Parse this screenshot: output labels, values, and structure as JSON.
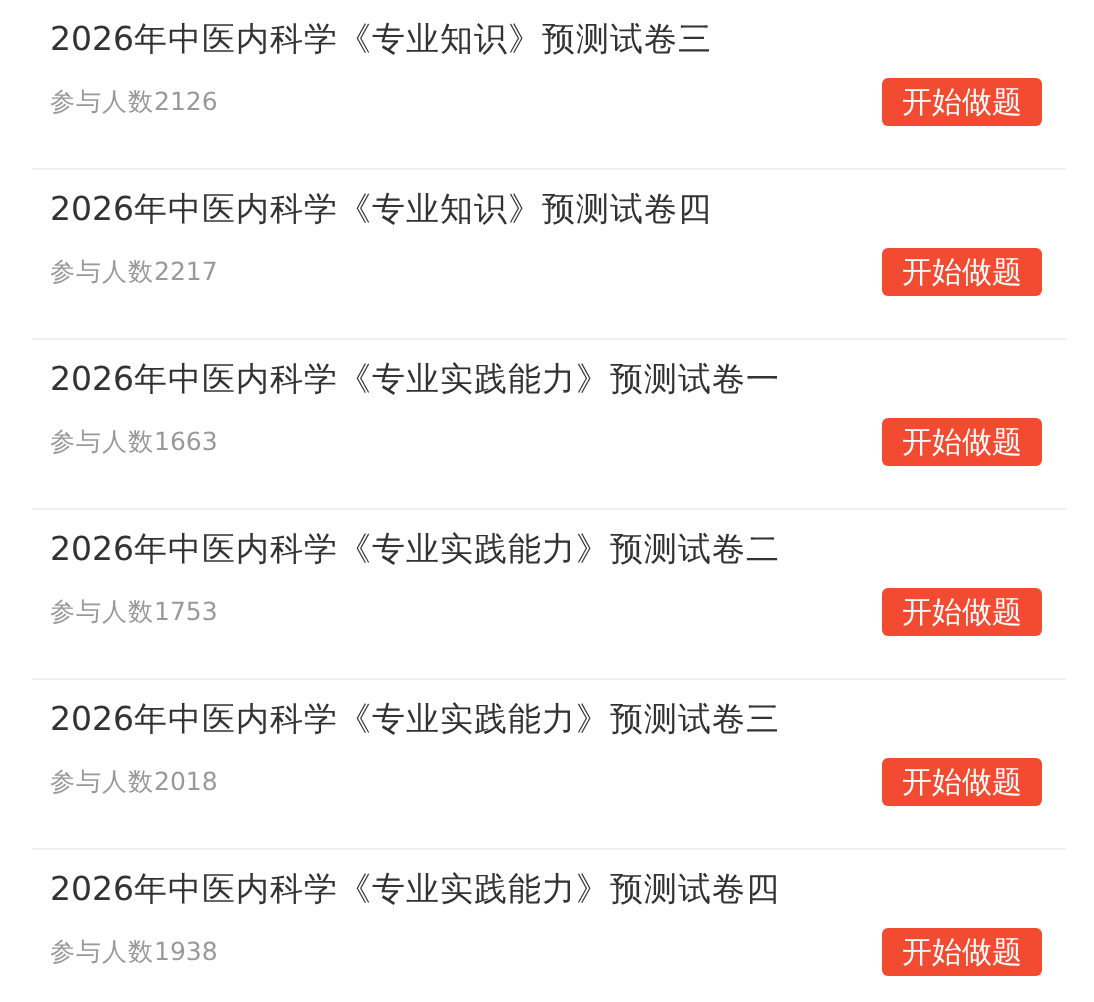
{
  "papers": [
    {
      "title": "2026年中医内科学《专业知识》预测试卷三",
      "participants": "参与人数2126",
      "button": "开始做题"
    },
    {
      "title": "2026年中医内科学《专业知识》预测试卷四",
      "participants": "参与人数2217",
      "button": "开始做题"
    },
    {
      "title": "2026年中医内科学《专业实践能力》预测试卷一",
      "participants": "参与人数1663",
      "button": "开始做题"
    },
    {
      "title": "2026年中医内科学《专业实践能力》预测试卷二",
      "participants": "参与人数1753",
      "button": "开始做题"
    },
    {
      "title": "2026年中医内科学《专业实践能力》预测试卷三",
      "participants": "参与人数2018",
      "button": "开始做题"
    },
    {
      "title": "2026年中医内科学《专业实践能力》预测试卷四",
      "participants": "参与人数1938",
      "button": "开始做题"
    }
  ]
}
